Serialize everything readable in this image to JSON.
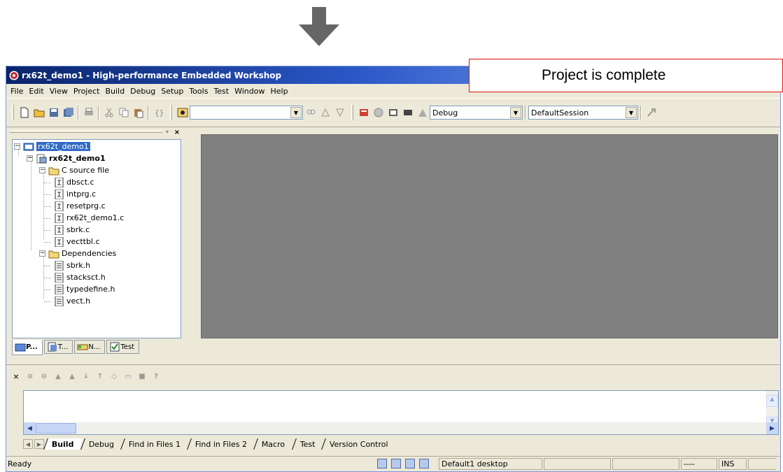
{
  "window": {
    "title": "rx62t_demo1 - High-performance Embedded Workshop"
  },
  "callout": {
    "text": "Project is complete"
  },
  "menu": [
    "File",
    "Edit",
    "View",
    "Project",
    "Build",
    "Debug",
    "Setup",
    "Tools",
    "Test",
    "Window",
    "Help"
  ],
  "toolbar": {
    "search_value": "",
    "config_value": "Debug",
    "session_value": "DefaultSession"
  },
  "tree": {
    "workspace": "rx62t_demo1",
    "project": "rx62t_demo1",
    "source_folder": "C source file",
    "source_files": [
      "dbsct.c",
      "intprg.c",
      "resetprg.c",
      "rx62t_demo1.c",
      "sbrk.c",
      "vecttbl.c"
    ],
    "deps_folder": "Dependencies",
    "dep_files": [
      "sbrk.h",
      "stacksct.h",
      "typedefine.h",
      "vect.h"
    ]
  },
  "workspace_tabs": [
    "P...",
    "T...",
    "N...",
    "Test"
  ],
  "output_tabs": [
    "Build",
    "Debug",
    "Find in Files 1",
    "Find in Files 2",
    "Macro",
    "Test",
    "Version Control"
  ],
  "status": {
    "text": "Ready",
    "desktop": "Default1 desktop",
    "indicator1": "----",
    "indicator2": "INS"
  },
  "colors": {
    "title_start": "#0a246a",
    "title_end": "#a6caf0",
    "selection": "#316ac5",
    "callout_border": "#e01010",
    "mdi_background": "#808080"
  }
}
